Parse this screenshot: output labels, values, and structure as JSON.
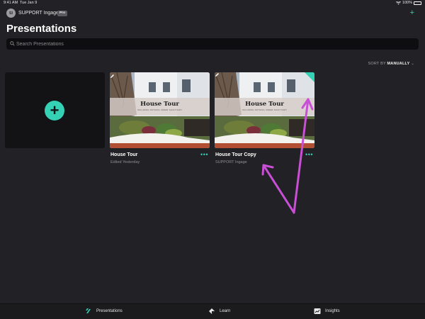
{
  "status_bar": {
    "time": "9:41 AM",
    "date": "Tue Jan 9",
    "battery_percent": "100%",
    "battery_level": 1.0
  },
  "header": {
    "avatar_initials": "SI",
    "org_name": "SUPPORT Ingage",
    "plan_badge": "Pro",
    "add_icon": "plus-icon"
  },
  "page_title": "Presentations",
  "search": {
    "placeholder": "Search Presentations"
  },
  "sort": {
    "label": "SORT BY",
    "value": "MANUALLY"
  },
  "new_presentation": {
    "icon": "plus-icon"
  },
  "presentations": [
    {
      "title": "House Tour",
      "subtitle": "Edited Yesterday",
      "thumb_title": "House Tour",
      "thumb_subtitle": "INCLUDING NOTHING UNDER SANCTUARY",
      "edit_badge": false
    },
    {
      "title": "House Tour Copy",
      "subtitle": "SUPPORT Ingage",
      "thumb_title": "House Tour",
      "thumb_subtitle": "INCLUDING NOTHING UNDER SANCTUARY",
      "edit_badge": true
    }
  ],
  "more_glyph": "•••",
  "tabs": [
    {
      "label": "Presentations",
      "icon": "presentations-icon"
    },
    {
      "label": "Learn",
      "icon": "learn-icon"
    },
    {
      "label": "Insights",
      "icon": "insights-icon"
    }
  ],
  "colors": {
    "accent": "#34d1b4",
    "background": "#222226",
    "annotation": "#c94fd6"
  }
}
